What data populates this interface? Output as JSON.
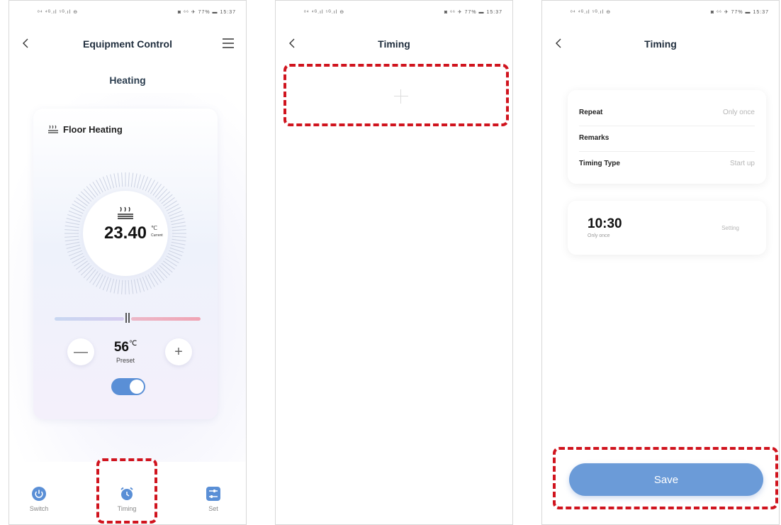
{
  "status_bar": {
    "left": "ᵒ⁴ ⁴ᴳ.ıl ⁵ᴳ.ıl ⊖",
    "right": "◙ ⁶⁶ ✈ 77% ▬ 15:37"
  },
  "screen1": {
    "nav_title": "Equipment Control",
    "section_title": "Heating",
    "device_name": "Floor Heating",
    "current_temp": "23.40",
    "current_unit": "℃",
    "current_caption": "Current",
    "preset_value": "56",
    "preset_unit": "℃",
    "preset_label": "Preset",
    "minus_symbol": "—",
    "plus_symbol": "+",
    "slider_position": 0.5,
    "power_on": true,
    "tabs": [
      {
        "label": "Switch",
        "icon": "power-icon"
      },
      {
        "label": "Timing",
        "icon": "alarm-clock-icon"
      },
      {
        "label": "Set",
        "icon": "sliders-icon"
      }
    ]
  },
  "screen2": {
    "nav_title": "Timing"
  },
  "screen3": {
    "nav_title": "Timing",
    "rows": [
      {
        "label": "Repeat",
        "value": "Only once"
      },
      {
        "label": "Remarks",
        "value": ""
      },
      {
        "label": "Timing Type",
        "value": "Start up"
      }
    ],
    "time": "10:30",
    "time_sub": "Only once",
    "time_setting": "Setting",
    "save_label": "Save"
  },
  "colors": {
    "highlight": "#d0141e",
    "accent": "#5a8fd6",
    "save": "#6b9bd8"
  }
}
